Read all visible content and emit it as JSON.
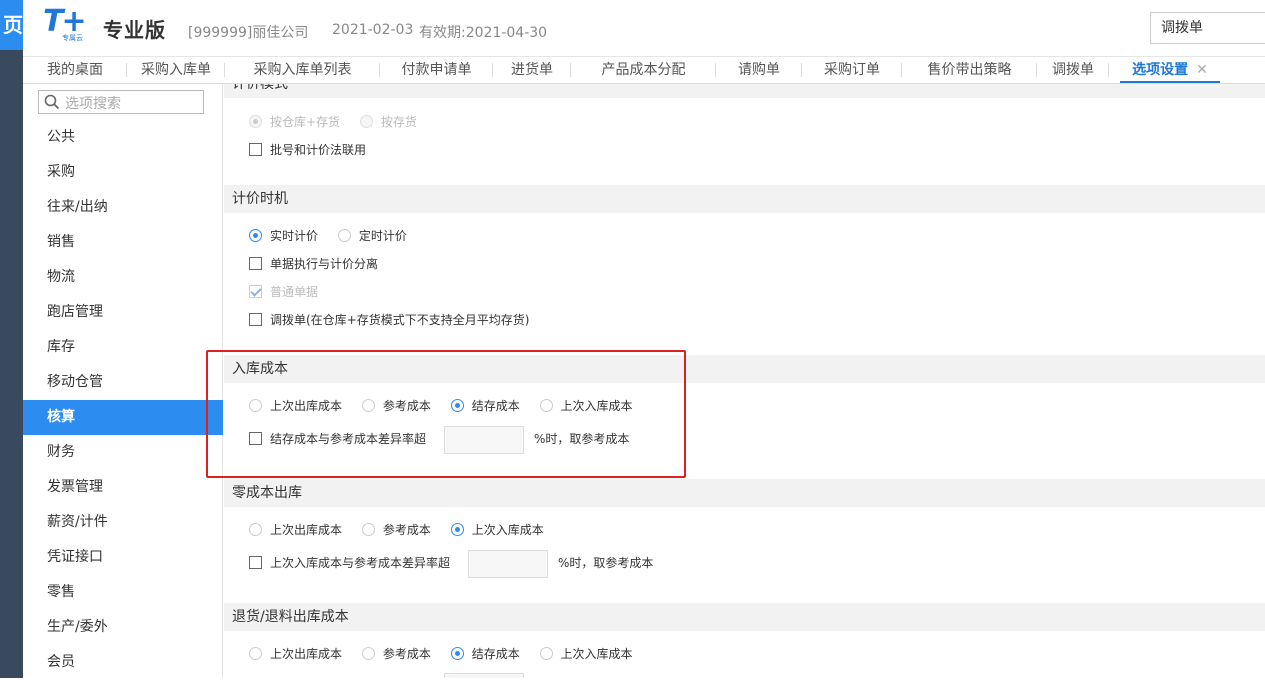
{
  "app": {
    "edge_char": "页",
    "logo_big": "T+",
    "logo_small": "专属云",
    "edition": "专业版",
    "company": "[999999]丽佳公司",
    "date": "2021-02-03",
    "validity": "有效期:2021-04-30",
    "quick_search_value": "调拨单"
  },
  "tabs": [
    {
      "label": "我的桌面"
    },
    {
      "label": "采购入库单"
    },
    {
      "label": "采购入库单列表"
    },
    {
      "label": "付款申请单"
    },
    {
      "label": "进货单"
    },
    {
      "label": "产品成本分配"
    },
    {
      "label": "请购单"
    },
    {
      "label": "采购订单"
    },
    {
      "label": "售价带出策略"
    },
    {
      "label": "调拨单"
    },
    {
      "label": "选项设置",
      "close": "✕"
    }
  ],
  "sidebar": {
    "search_placeholder": "选项搜索",
    "items": [
      {
        "label": "公共"
      },
      {
        "label": "采购"
      },
      {
        "label": "往来/出纳"
      },
      {
        "label": "销售"
      },
      {
        "label": "物流"
      },
      {
        "label": "跑店管理"
      },
      {
        "label": "库存"
      },
      {
        "label": "移动仓管"
      },
      {
        "label": "核算"
      },
      {
        "label": "财务"
      },
      {
        "label": "发票管理"
      },
      {
        "label": "薪资/计件"
      },
      {
        "label": "凭证接口"
      },
      {
        "label": "零售"
      },
      {
        "label": "生产/委外"
      },
      {
        "label": "会员"
      }
    ]
  },
  "sections": {
    "pricing_mode": {
      "title": "计价模式",
      "opt1": "按仓库+存货",
      "opt2": "按存货",
      "check1": "批号和计价法联用"
    },
    "pricing_timing": {
      "title": "计价时机",
      "opt1": "实时计价",
      "opt2": "定时计价",
      "check1": "单据执行与计价分离",
      "check2": "普通单据",
      "check3": "调拨单(在仓库+存货模式下不支持全月平均存货)"
    },
    "inbound_cost": {
      "title": "入库成本",
      "opt1": "上次出库成本",
      "opt2": "参考成本",
      "opt3": "结存成本",
      "opt4": "上次入库成本",
      "check1": "结存成本与参考成本差异率超",
      "suffix": "%时，取参考成本"
    },
    "zero_cost": {
      "title": "零成本出库",
      "opt1": "上次出库成本",
      "opt2": "参考成本",
      "opt3": "上次入库成本",
      "check1": "上次入库成本与参考成本差异率超",
      "suffix": "%时，取参考成本"
    },
    "return_cost": {
      "title": "退货/退料出库成本",
      "opt1": "上次出库成本",
      "opt2": "参考成本",
      "opt3": "结存成本",
      "opt4": "上次入库成本"
    }
  },
  "colors": {
    "accent": "#2d8cf0",
    "highlight_box": "#e02020"
  }
}
